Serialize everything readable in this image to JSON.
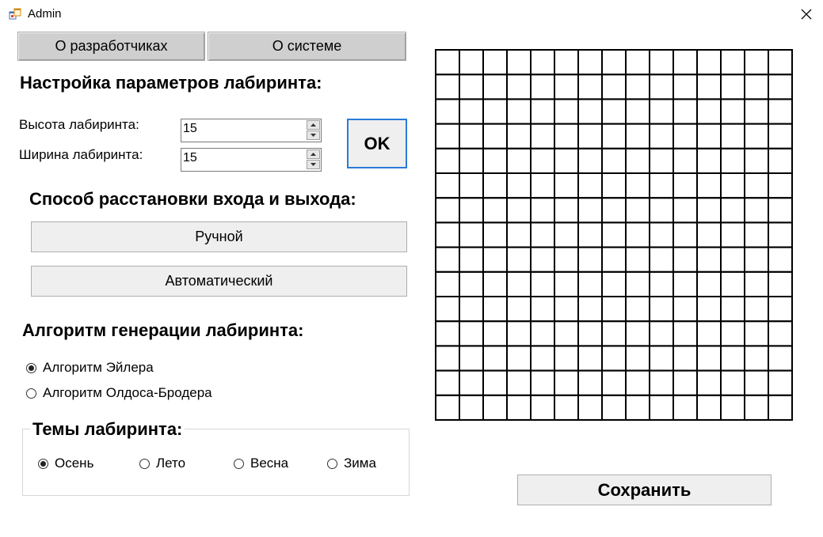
{
  "window": {
    "title": "Admin",
    "icon": "app-window-icon",
    "close_icon": "close-icon"
  },
  "top_buttons": {
    "developers": "О разработчиках",
    "system": "О системе"
  },
  "settings": {
    "heading": "Настройка параметров лабиринта:",
    "height_label": "Высота лабиринта:",
    "height_value": "15",
    "width_label": "Ширина лабиринта:",
    "width_value": "15",
    "ok_label": "OK"
  },
  "entry_exit": {
    "heading": "Способ расстановки входа и выхода:",
    "manual": "Ручной",
    "automatic": "Автоматический"
  },
  "algorithm": {
    "heading": "Алгоритм генерации лабиринта:",
    "options": [
      {
        "label": "Алгоритм Эйлера",
        "selected": true
      },
      {
        "label": "Алгоритм Олдоса-Бродера",
        "selected": false
      }
    ]
  },
  "themes": {
    "heading": "Темы лабиринта:",
    "options": [
      {
        "label": "Осень",
        "selected": true
      },
      {
        "label": "Лето",
        "selected": false
      },
      {
        "label": "Весна",
        "selected": false
      },
      {
        "label": "Зима",
        "selected": false
      }
    ]
  },
  "maze": {
    "rows": 15,
    "cols": 15,
    "line_color": "#000000",
    "cell_color": "#ffffff"
  },
  "save_label": "Сохранить"
}
